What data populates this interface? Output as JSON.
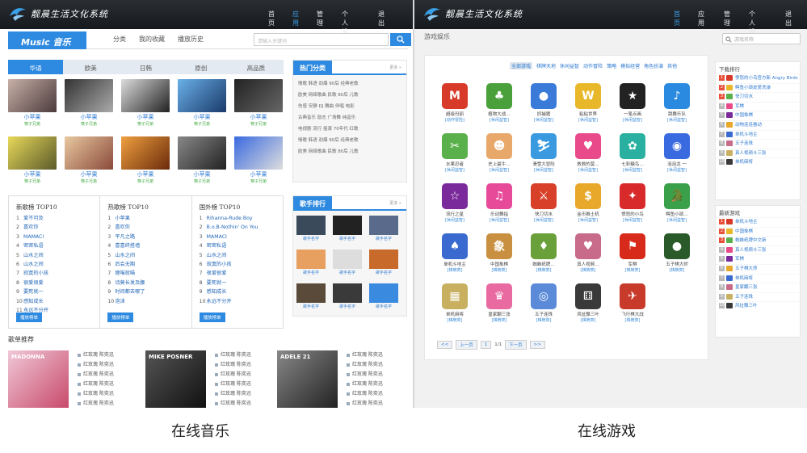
{
  "left": {
    "logo_text": "靓晨生活文化系统",
    "nav": [
      "首页",
      "应用",
      "管理",
      "个人设置",
      "退出"
    ],
    "nav_active": 1,
    "music_logo": "Music 音乐",
    "tabs": [
      "分类",
      "我的收藏",
      "播放历史"
    ],
    "search_placeholder": "请输入关键词",
    "categories": [
      "华语",
      "欧美",
      "日韩",
      "原创",
      "高品质"
    ],
    "grid_items": [
      {
        "name": "小苹果",
        "sub": "筷子兄弟"
      },
      {
        "name": "小苹果",
        "sub": "筷子兄弟"
      },
      {
        "name": "小苹果",
        "sub": "筷子兄弟"
      },
      {
        "name": "小苹果",
        "sub": "筷子兄弟"
      },
      {
        "name": "小苹果",
        "sub": "筷子兄弟"
      },
      {
        "name": "小苹果",
        "sub": "筷子兄弟"
      },
      {
        "name": "小苹果",
        "sub": "筷子兄弟"
      },
      {
        "name": "小苹果",
        "sub": "筷子兄弟"
      },
      {
        "name": "小苹果",
        "sub": "筷子兄弟"
      },
      {
        "name": "小苹果",
        "sub": "筷子兄弟"
      }
    ],
    "hot": {
      "title": "热门分类",
      "more": "更多 »",
      "lines": [
        "情歌 韩语 劲爆 90后 经典老歌",
        "欧美 网络歌曲 民歌 80后 儿歌",
        "伤感 安静 DJ 舞曲 伴唱 电影",
        "古典音乐 励志 广场舞 纯音乐",
        "电视剧 流行 摇滚 70年代 红歌",
        "情歌 韩语 劲爆 90后 经典老歌",
        "欧美 网络歌曲 民歌 80后 儿歌"
      ]
    },
    "singers": {
      "title": "歌手排行",
      "more": "更多 »",
      "items": [
        "歌手名字",
        "歌手名字",
        "歌手名字",
        "歌手名字",
        "歌手名字",
        "歌手名字",
        "歌手名字",
        "歌手名字",
        "歌手名字"
      ]
    },
    "charts": [
      {
        "title": "新歌榜 TOP10",
        "items": [
          "爱不可及",
          "喜欢你",
          "MAMACI",
          "密密私语",
          "山水之间",
          "山水之间",
          "寂寞的小孩",
          "很爱很爱",
          "要死就一",
          "感知成长",
          "永远不分开"
        ]
      },
      {
        "title": "热歌榜 TOP10",
        "items": [
          "小苹果",
          "喜欢你",
          "平凡之路",
          "喜喜终搭墙",
          "山水之间",
          "后会无期",
          "瘦喵就喵",
          "诗莫长发及腰",
          "时间都去哪了",
          "泡沫"
        ]
      },
      {
        "title": "国外榜 TOP10",
        "items": [
          "Rihanna-Rude Boy",
          "B.o.B-Nothin' On You",
          "MAMACI",
          "密密私语",
          "山水之间",
          "寂寞的小孩",
          "很爱很爱",
          "要死就一",
          "感知成长",
          "永远不分开"
        ]
      }
    ],
    "chart_btn": "播放榜单",
    "song_recommend": "歌单推荐",
    "album_labels": [
      "MADONNA",
      "MIKE POSNER",
      "ADELE 21"
    ],
    "album_songs": [
      "红玫瑰 陈奕迅",
      "红玫瑰 陈奕迅",
      "红玫瑰 陈奕迅",
      "红玫瑰 陈奕迅",
      "红玫瑰 陈奕迅",
      "红玫瑰 陈奕迅"
    ],
    "caption": "在线音乐"
  },
  "right": {
    "logo_text": "靓晨生活文化系统",
    "nav": [
      "首页",
      "应用",
      "管理",
      "个人设置",
      "退出"
    ],
    "nav_active": 0,
    "title": "游戏娱乐",
    "search_placeholder": "游戏名称",
    "categories": [
      "全部游戏",
      "棋牌天地",
      "休闲益智",
      "动作冒险",
      "策略",
      "模拟经营",
      "角色扮演",
      "其他"
    ],
    "games": [
      {
        "name": "超级玛丽",
        "genre": "[动作冒险]"
      },
      {
        "name": "植物大战…",
        "genre": "[休闲益智]"
      },
      {
        "name": "抓捕猪",
        "genre": "[休闲益智]"
      },
      {
        "name": "粘粘世界",
        "genre": "[休闲益智]"
      },
      {
        "name": "一笔点画",
        "genre": "[休闲益智]"
      },
      {
        "name": "跳舞乐队",
        "genre": "[休闲益智]"
      },
      {
        "name": "水果忍者",
        "genre": "[休闲益智]"
      },
      {
        "name": "史上最牛…",
        "genre": "[休闲益智]"
      },
      {
        "name": "滑雪大冒险",
        "genre": "[休闲益智]"
      },
      {
        "name": "救救的莫…",
        "genre": "[休闲益智]"
      },
      {
        "name": "七彩糖鸟…",
        "genre": "[休闲益智]"
      },
      {
        "name": "泡泡龙 一",
        "genre": "[休闲益智]"
      },
      {
        "name": "流行之星",
        "genre": "[休闲益智]"
      },
      {
        "name": "乐动舞指",
        "genre": "[休闲益智]"
      },
      {
        "name": "快刀切水",
        "genre": "[休闲益智]"
      },
      {
        "name": "金币推土机",
        "genre": "[休闲益智]"
      },
      {
        "name": "愤怒的小鸟",
        "genre": "[休闲益智]"
      },
      {
        "name": "鳄鱼小顽…",
        "genre": "[休闲益智]"
      },
      {
        "name": "单机斗地主",
        "genre": "[棋牌类]"
      },
      {
        "name": "中国象棋",
        "genre": "[棋牌类]"
      },
      {
        "name": "蜘蛛纸牌…",
        "genre": "[棋牌类]"
      },
      {
        "name": "真人视频…",
        "genre": "[棋牌类]"
      },
      {
        "name": "军棋",
        "genre": "[棋牌类]"
      },
      {
        "name": "五子棋大师",
        "genre": "[棋牌类]"
      },
      {
        "name": "单机麻将",
        "genre": "[棋牌类]"
      },
      {
        "name": "皇家翻三张",
        "genre": "[棋牌类]"
      },
      {
        "name": "五子连珠",
        "genre": "[棋牌类]"
      },
      {
        "name": "风扯飘三叶",
        "genre": "[棋牌类]"
      },
      {
        "name": "飞行棋大战",
        "genre": "[棋牌类]"
      }
    ],
    "icon_colors": [
      "#d83a2a",
      "#4aa03a",
      "#3a7ad8",
      "#e8b82a",
      "#222222",
      "#2a8ae0",
      "#5ab04a",
      "#e8a86a",
      "#3a9ae0",
      "#e84a8a",
      "#2ab0a0",
      "#3a6ae0",
      "#7a2a9a",
      "#e84a9a",
      "#d8402a",
      "#e8a82a",
      "#d82a2a",
      "#3aa04a",
      "#3a6ad0",
      "#c89040",
      "#6aa03a",
      "#c86a8a",
      "#d82a1a",
      "#2a5a2a",
      "#c8b060",
      "#e86aa0",
      "#5a8ad8",
      "#3a3a3a",
      "#c83a2a"
    ],
    "icon_glyphs": [
      "M",
      "♣",
      "●",
      "W",
      "★",
      "♪",
      "✂",
      "☻",
      "⛷",
      "♥",
      "✿",
      "◉",
      "☆",
      "♫",
      "⚔",
      "$",
      "✦",
      "🐊",
      "♠",
      "象",
      "♦",
      "♥",
      "⚑",
      "●",
      "▦",
      "♛",
      "◎",
      "⚅",
      "✈"
    ],
    "pager": [
      "<<",
      "上一页",
      "1",
      "1/1",
      "下一页",
      ">>"
    ],
    "download": {
      "title": "下载排行",
      "items": [
        "愤怒的小鸟官方新 Angry Birds",
        "鳄鱼小顽皮爱洗澡",
        "快刀切水",
        "军棋",
        "中国象棋",
        "动物连连看动",
        "单机斗地主",
        "五子连珠",
        "真人视频斗三张",
        "单机麻将"
      ]
    },
    "latest": {
      "title": "最新游戏",
      "items": [
        "单机斗地主",
        "中国象棋",
        "蜘蛛纸牌中文新",
        "真人视频斗三张",
        "军棋",
        "五子棋大师",
        "单机麻将",
        "皇家翻三张",
        "五子连珠",
        "风扯飘三叶"
      ]
    },
    "caption": "在线游戏"
  }
}
